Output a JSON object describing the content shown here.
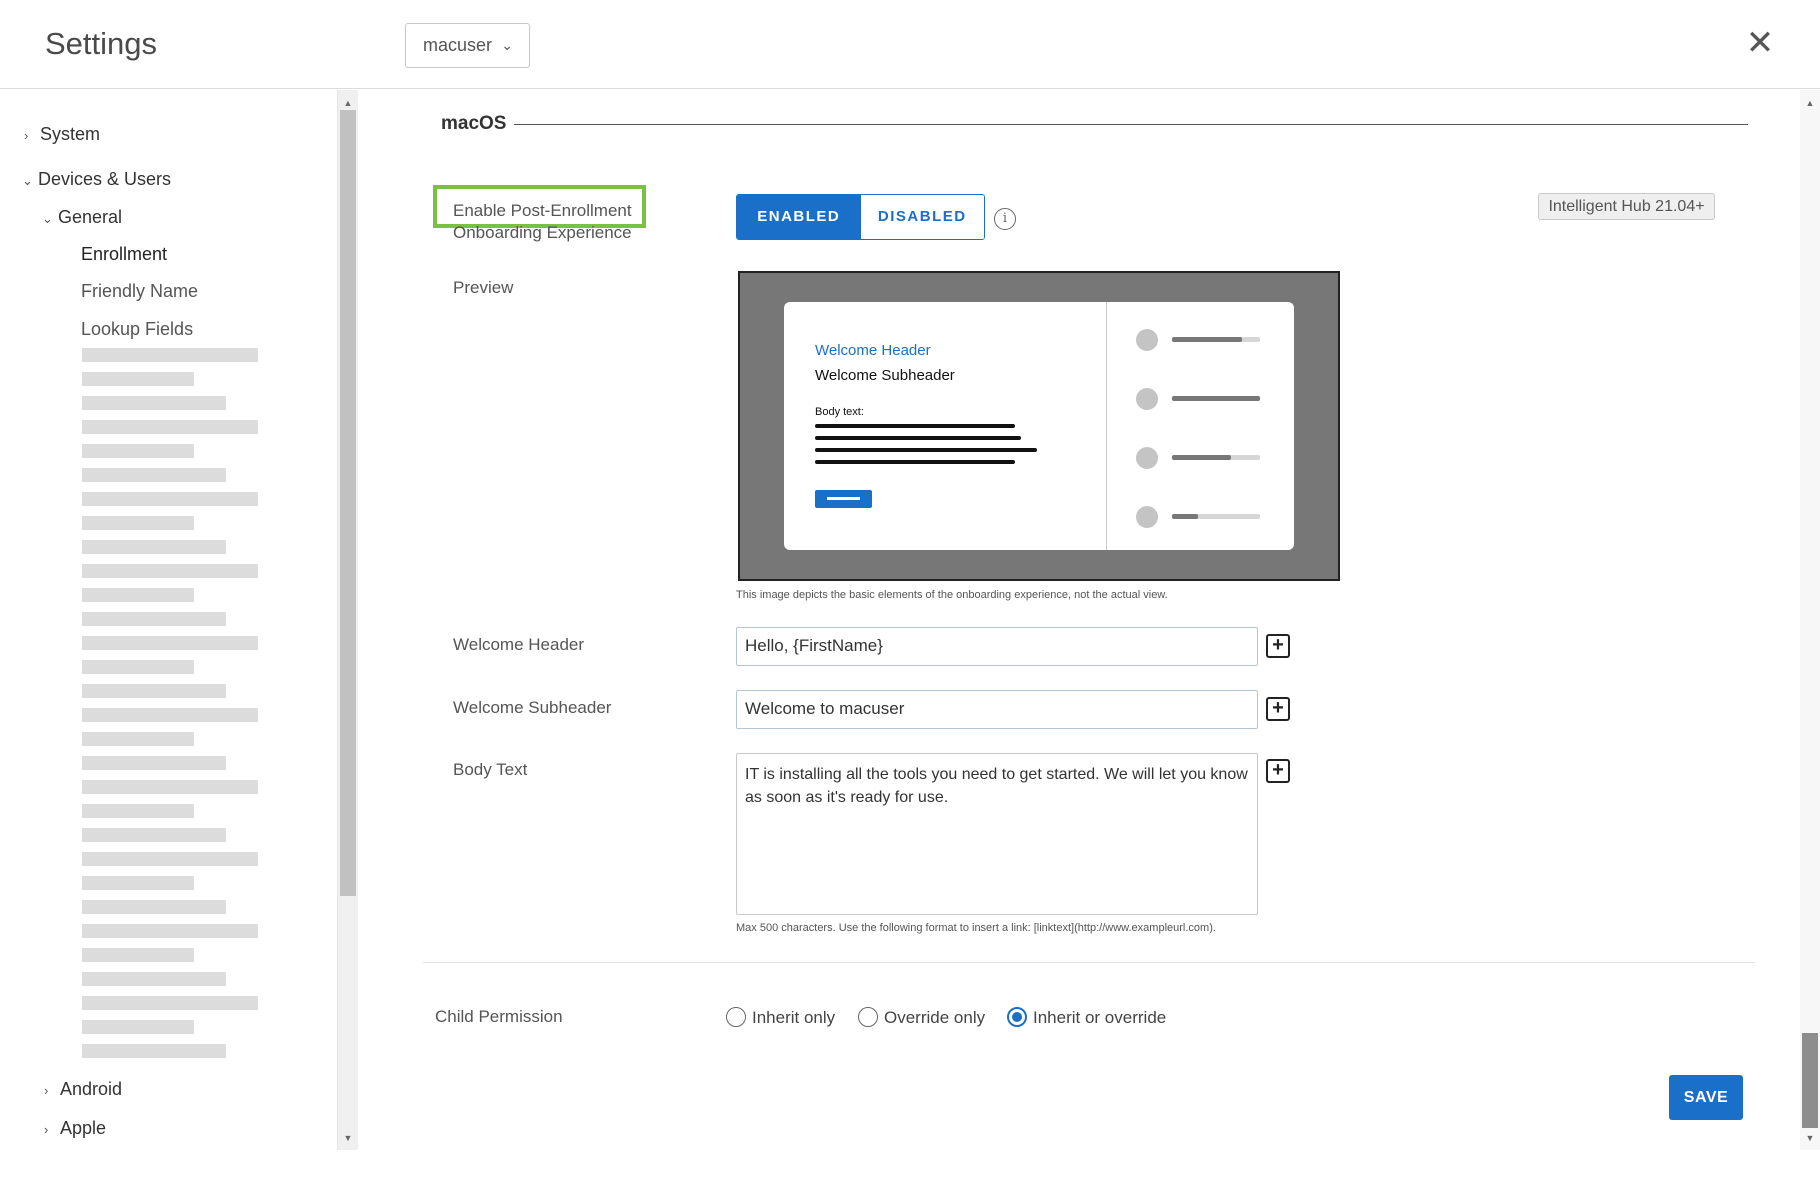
{
  "header": {
    "title": "Settings",
    "org_dropdown": "macuser",
    "close_icon": "close-icon"
  },
  "sidebar": {
    "system": "System",
    "devices_users": "Devices & Users",
    "general": "General",
    "enrollment": "Enrollment",
    "friendly_name": "Friendly Name",
    "lookup_fields": "Lookup Fields",
    "android": "Android",
    "apple": "Apple"
  },
  "section": {
    "title": "macOS"
  },
  "onboarding": {
    "label_line1": "Enable Post-Enrollment",
    "label_line2": "Onboarding Experience",
    "enabled": "ENABLED",
    "disabled": "DISABLED",
    "selected": "ENABLED",
    "version_badge": "Intelligent Hub 21.04+"
  },
  "preview": {
    "label": "Preview",
    "welcome_header": "Welcome Header",
    "welcome_subheader": "Welcome Subheader",
    "body_text": "Body text:",
    "caption": "This image depicts the basic elements of the onboarding experience, not the actual view.",
    "progress_levels": [
      0.8,
      1.0,
      0.67,
      0.3
    ]
  },
  "fields": {
    "welcome_header_label": "Welcome Header",
    "welcome_header_value": "Hello, {FirstName}",
    "welcome_subheader_label": "Welcome Subheader",
    "welcome_subheader_value": "Welcome to macuser",
    "body_text_label": "Body Text",
    "body_text_value": "IT is installing all the tools you need to get started. We will let you know as soon as it's ready for use.",
    "body_text_hint": "Max 500 characters. Use the following format to insert a link: [linktext](http://www.exampleurl.com)."
  },
  "child_permission": {
    "label": "Child Permission",
    "options": [
      "Inherit only",
      "Override only",
      "Inherit or override"
    ],
    "selected": "Inherit or override"
  },
  "footer": {
    "save": "SAVE"
  },
  "colors": {
    "accent": "#1a6fc9",
    "highlight": "#7ac143"
  }
}
